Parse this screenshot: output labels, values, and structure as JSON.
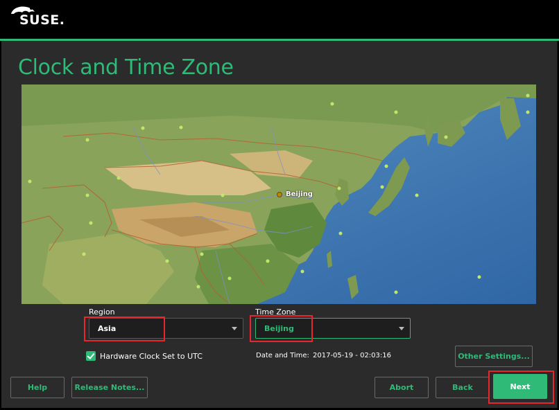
{
  "brand": {
    "logo_text": "SUSE."
  },
  "page": {
    "title": "Clock and Time Zone"
  },
  "map": {
    "selected_city": "Beijing"
  },
  "region": {
    "label": "Region",
    "value": "Asia"
  },
  "timezone": {
    "label": "Time Zone",
    "value": "Beijing"
  },
  "hwclock": {
    "label": "Hardware Clock Set to UTC",
    "checked": true
  },
  "datetime": {
    "label": "Date and Time:",
    "value": "2017-05-19 - 02:03:16"
  },
  "buttons": {
    "other_settings": "Other Settings...",
    "help": "Help",
    "release_notes": "Release Notes...",
    "abort": "Abort",
    "back": "Back",
    "next": "Next"
  },
  "colors": {
    "accent": "#30ba78",
    "highlight": "#e8262c",
    "panel": "#2b2b2b"
  }
}
